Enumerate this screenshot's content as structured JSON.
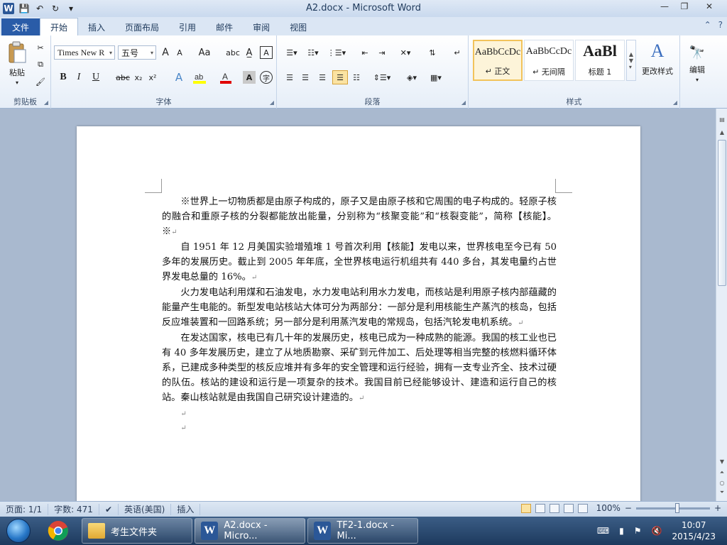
{
  "window": {
    "title": "A2.docx - Microsoft Word"
  },
  "qat": {
    "word_logo": "W",
    "save": "💾",
    "undo": "↶",
    "redo": "↻",
    "customize": "▾"
  },
  "window_controls": {
    "minimize": "—",
    "restore": "❐",
    "close": "✕"
  },
  "tabs": [
    "文件",
    "开始",
    "插入",
    "页面布局",
    "引用",
    "邮件",
    "审阅",
    "视图"
  ],
  "ribbon": {
    "clipboard": {
      "label": "剪贴板",
      "paste": "粘贴"
    },
    "font": {
      "label": "字体",
      "font_name": "Times New R",
      "font_size": "五号",
      "bold": "B",
      "italic": "I",
      "underline": "U",
      "strike": "abc",
      "sub": "x₂",
      "sup": "x²",
      "grow": "A",
      "shrink": "A",
      "case": "Aa",
      "clear": "A"
    },
    "paragraph": {
      "label": "段落"
    },
    "styles": {
      "label": "样式",
      "items": [
        {
          "sample": "AaBbCcDc",
          "name": "↵ 正文"
        },
        {
          "sample": "AaBbCcDc",
          "name": "↵ 无间隔"
        },
        {
          "sample": "AaBl",
          "name": "标题 1"
        }
      ],
      "change_styles": "更改样式"
    },
    "editing": {
      "label": "编辑"
    }
  },
  "document": {
    "paragraphs": [
      "※世界上一切物质都是由原子构成的，原子又是由原子核和它周围的电子构成的。轻原子核的融合和重原子核的分裂都能放出能量，分别称为“核聚变能”和“核裂变能”，简称【核能】。※",
      "自 1951 年 12 月美国实验增殖堆 1 号首次利用【核能】发电以来，世界核电至今已有 50 多年的发展历史。截止到 2005 年年底，全世界核电运行机组共有 440 多台，其发电量约占世界发电总量的 16%。",
      "火力发电站利用煤和石油发电，水力发电站利用水力发电，而核站是利用原子核内部蕴藏的能量产生电能的。新型发电站核站大体可分为两部分：一部分是利用核能生产蒸汽的核岛，包括反应堆装置和一回路系统；另一部分是利用蒸汽发电的常规岛，包括汽轮发电机系统。",
      "在发达国家，核电已有几十年的发展历史，核电已成为一种成熟的能源。我国的核工业也已有 40 多年发展历史，建立了从地质勘察、采矿到元件加工、后处理等相当完整的核燃料循环体系，已建成多种类型的核反应堆并有多年的安全管理和运行经验，拥有一支专业齐全、技术过硬的队伍。核站的建设和运行是一项复杂的技术。我国目前已经能够设计、建造和运行自己的核站。秦山核站就是由我国自己研究设计建造的。"
    ],
    "para_mark": "↵"
  },
  "status": {
    "page": "页面: 1/1",
    "words": "字数: 471",
    "language": "英语(美国)",
    "mode": "插入",
    "zoom": "100%",
    "zoom_minus": "−",
    "zoom_plus": "+"
  },
  "taskbar": {
    "items": [
      {
        "label": "考生文件夹"
      },
      {
        "label": "A2.docx - Micro..."
      },
      {
        "label": "TF2-1.docx - Mi..."
      }
    ],
    "time": "10:07",
    "date": "2015/4/23"
  }
}
